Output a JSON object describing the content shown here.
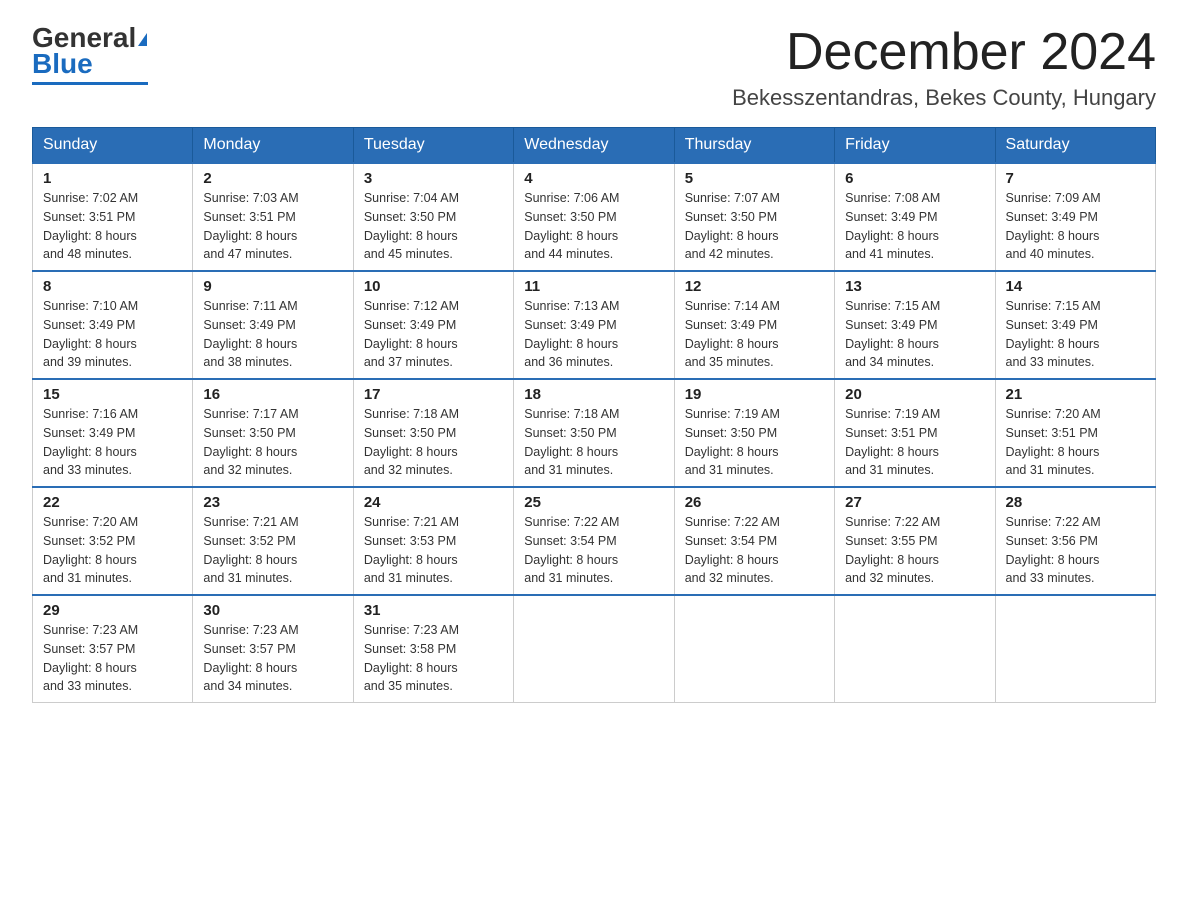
{
  "header": {
    "logo": {
      "general": "General",
      "triangle": "▶",
      "blue": "Blue"
    },
    "title": "December 2024",
    "location": "Bekesszentandras, Bekes County, Hungary"
  },
  "days_of_week": [
    "Sunday",
    "Monday",
    "Tuesday",
    "Wednesday",
    "Thursday",
    "Friday",
    "Saturday"
  ],
  "weeks": [
    [
      {
        "num": "1",
        "sunrise": "7:02 AM",
        "sunset": "3:51 PM",
        "daylight": "8 hours and 48 minutes."
      },
      {
        "num": "2",
        "sunrise": "7:03 AM",
        "sunset": "3:51 PM",
        "daylight": "8 hours and 47 minutes."
      },
      {
        "num": "3",
        "sunrise": "7:04 AM",
        "sunset": "3:50 PM",
        "daylight": "8 hours and 45 minutes."
      },
      {
        "num": "4",
        "sunrise": "7:06 AM",
        "sunset": "3:50 PM",
        "daylight": "8 hours and 44 minutes."
      },
      {
        "num": "5",
        "sunrise": "7:07 AM",
        "sunset": "3:50 PM",
        "daylight": "8 hours and 42 minutes."
      },
      {
        "num": "6",
        "sunrise": "7:08 AM",
        "sunset": "3:49 PM",
        "daylight": "8 hours and 41 minutes."
      },
      {
        "num": "7",
        "sunrise": "7:09 AM",
        "sunset": "3:49 PM",
        "daylight": "8 hours and 40 minutes."
      }
    ],
    [
      {
        "num": "8",
        "sunrise": "7:10 AM",
        "sunset": "3:49 PM",
        "daylight": "8 hours and 39 minutes."
      },
      {
        "num": "9",
        "sunrise": "7:11 AM",
        "sunset": "3:49 PM",
        "daylight": "8 hours and 38 minutes."
      },
      {
        "num": "10",
        "sunrise": "7:12 AM",
        "sunset": "3:49 PM",
        "daylight": "8 hours and 37 minutes."
      },
      {
        "num": "11",
        "sunrise": "7:13 AM",
        "sunset": "3:49 PM",
        "daylight": "8 hours and 36 minutes."
      },
      {
        "num": "12",
        "sunrise": "7:14 AM",
        "sunset": "3:49 PM",
        "daylight": "8 hours and 35 minutes."
      },
      {
        "num": "13",
        "sunrise": "7:15 AM",
        "sunset": "3:49 PM",
        "daylight": "8 hours and 34 minutes."
      },
      {
        "num": "14",
        "sunrise": "7:15 AM",
        "sunset": "3:49 PM",
        "daylight": "8 hours and 33 minutes."
      }
    ],
    [
      {
        "num": "15",
        "sunrise": "7:16 AM",
        "sunset": "3:49 PM",
        "daylight": "8 hours and 33 minutes."
      },
      {
        "num": "16",
        "sunrise": "7:17 AM",
        "sunset": "3:50 PM",
        "daylight": "8 hours and 32 minutes."
      },
      {
        "num": "17",
        "sunrise": "7:18 AM",
        "sunset": "3:50 PM",
        "daylight": "8 hours and 32 minutes."
      },
      {
        "num": "18",
        "sunrise": "7:18 AM",
        "sunset": "3:50 PM",
        "daylight": "8 hours and 31 minutes."
      },
      {
        "num": "19",
        "sunrise": "7:19 AM",
        "sunset": "3:50 PM",
        "daylight": "8 hours and 31 minutes."
      },
      {
        "num": "20",
        "sunrise": "7:19 AM",
        "sunset": "3:51 PM",
        "daylight": "8 hours and 31 minutes."
      },
      {
        "num": "21",
        "sunrise": "7:20 AM",
        "sunset": "3:51 PM",
        "daylight": "8 hours and 31 minutes."
      }
    ],
    [
      {
        "num": "22",
        "sunrise": "7:20 AM",
        "sunset": "3:52 PM",
        "daylight": "8 hours and 31 minutes."
      },
      {
        "num": "23",
        "sunrise": "7:21 AM",
        "sunset": "3:52 PM",
        "daylight": "8 hours and 31 minutes."
      },
      {
        "num": "24",
        "sunrise": "7:21 AM",
        "sunset": "3:53 PM",
        "daylight": "8 hours and 31 minutes."
      },
      {
        "num": "25",
        "sunrise": "7:22 AM",
        "sunset": "3:54 PM",
        "daylight": "8 hours and 31 minutes."
      },
      {
        "num": "26",
        "sunrise": "7:22 AM",
        "sunset": "3:54 PM",
        "daylight": "8 hours and 32 minutes."
      },
      {
        "num": "27",
        "sunrise": "7:22 AM",
        "sunset": "3:55 PM",
        "daylight": "8 hours and 32 minutes."
      },
      {
        "num": "28",
        "sunrise": "7:22 AM",
        "sunset": "3:56 PM",
        "daylight": "8 hours and 33 minutes."
      }
    ],
    [
      {
        "num": "29",
        "sunrise": "7:23 AM",
        "sunset": "3:57 PM",
        "daylight": "8 hours and 33 minutes."
      },
      {
        "num": "30",
        "sunrise": "7:23 AM",
        "sunset": "3:57 PM",
        "daylight": "8 hours and 34 minutes."
      },
      {
        "num": "31",
        "sunrise": "7:23 AM",
        "sunset": "3:58 PM",
        "daylight": "8 hours and 35 minutes."
      },
      null,
      null,
      null,
      null
    ]
  ]
}
